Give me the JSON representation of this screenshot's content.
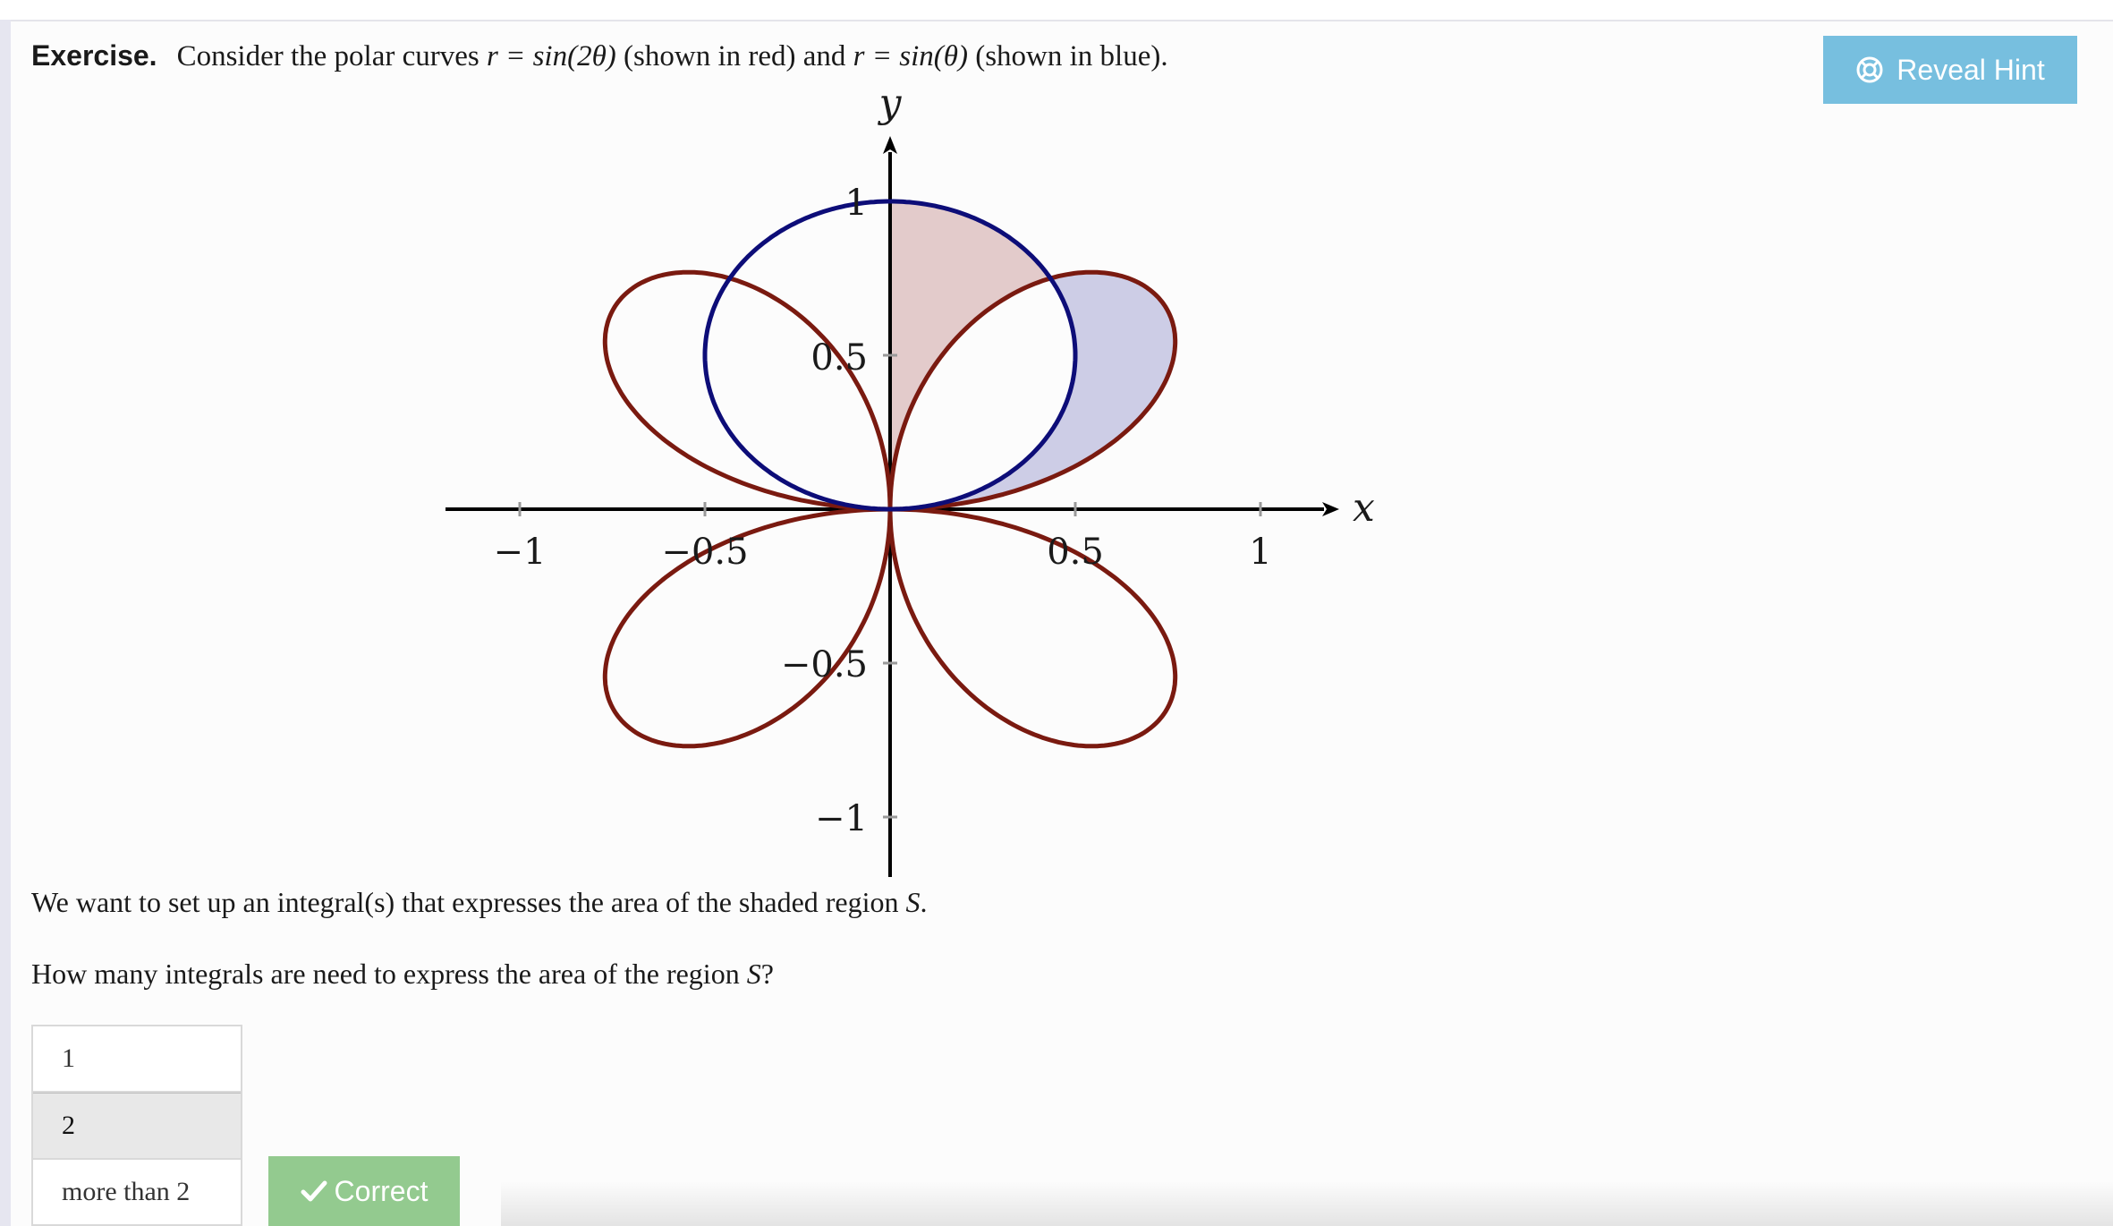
{
  "exercise": {
    "label": "Exercise.",
    "prefix": "Consider the polar curves ",
    "curve1": "r = sin(2θ)",
    "middle1": " (shown in red) and ",
    "curve2": "r = sin(θ)",
    "suffix": " (shown in blue)."
  },
  "hint_button": {
    "label": "Reveal Hint",
    "icon": "lifebuoy-icon"
  },
  "figure": {
    "x_axis_label": "x",
    "y_axis_label": "y",
    "x_ticks": [
      "−1",
      "−0.5",
      "0.5",
      "1"
    ],
    "y_ticks": [
      "1",
      "0.5",
      "−0.5",
      "−1"
    ],
    "colors": {
      "rose_curve": "#7a1a10",
      "circle_curve": "#0d0d78",
      "shade_red": "#e3cbcb",
      "shade_blue": "#cdcde6"
    }
  },
  "question": {
    "setup_prefix": "We want to set up an integral(s) that expresses the area of the shaded region ",
    "setup_symbol": "S",
    "setup_suffix": ".",
    "prompt_prefix": "How many integrals are need to express the area of the region ",
    "prompt_symbol": "S",
    "prompt_suffix": "?"
  },
  "options": [
    "1",
    "2",
    "more than 2"
  ],
  "selected_option": "2",
  "feedback_button": {
    "label": "Correct",
    "icon": "checkmark-icon"
  }
}
